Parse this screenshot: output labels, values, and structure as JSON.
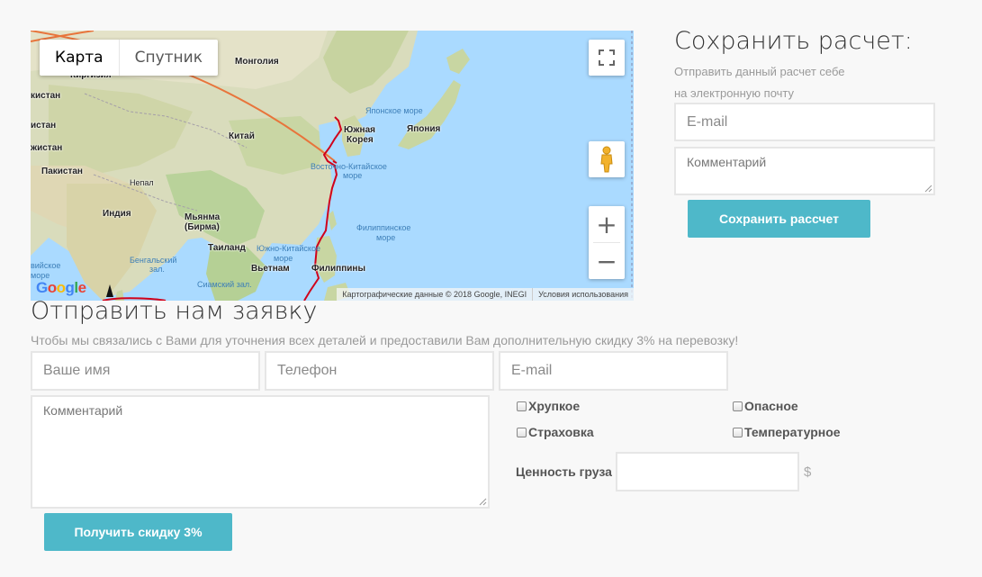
{
  "map": {
    "type_controls": {
      "map_label": "Карта",
      "satellite_label": "Спутник"
    },
    "labels": {
      "mongolia": "Монголия",
      "kyrgyzstan": "Киргизия",
      "stan_fragment": "кистан",
      "stan_fragment2": "истан",
      "china": "Китай",
      "stan_fragment3": "жистан",
      "pakistan": "Пакистан",
      "nepal": "Непал",
      "india": "Индия",
      "myanmar": "Мьянма",
      "myanmar_alt": "(Бирма)",
      "thailand": "Таиланд",
      "vietnam": "Вьетнам",
      "philippines": "Филиппины",
      "south_korea": "Южная",
      "south_korea2": "Корея",
      "japan": "Япония",
      "sea_japan": "Японское море",
      "east_china_sea": "Восточно-Китайское",
      "east_china_sea2": "море",
      "philippine_sea": "Филиппинское",
      "philippine_sea2": "море",
      "south_china_sea": "Южно-Китайское",
      "south_china_sea2": "море",
      "bengal": "Бенгальский",
      "bengal2": "зал.",
      "siam": "Сиамский зал.",
      "arabian": "вийское",
      "arabian2": "море"
    },
    "google_logo": "Google",
    "attribution": "Картографические данные © 2018 Google, INEGI",
    "terms": "Условия использования",
    "zoom_in": "+",
    "zoom_out": "−"
  },
  "save_calc": {
    "title": "Сохранить расчет:",
    "desc_line1": "Отправить данный расчет себе",
    "desc_line2": "на электронную почту",
    "email_placeholder": "E-mail",
    "comment_placeholder": "Комментарий",
    "button": "Сохранить рассчет"
  },
  "order": {
    "title": "Отправить нам заявку",
    "description": "Чтобы мы связались с Вами для уточнения всех деталей и предоставили Вам дополнительную скидку 3% на перевозку!",
    "name_placeholder": "Ваше имя",
    "phone_placeholder": "Телефон",
    "email_placeholder": "E-mail",
    "comment_placeholder": "Комментарий",
    "checkboxes": {
      "fragile": "Хрупкое",
      "dangerous": "Опасное",
      "insurance": "Страховка",
      "temperature": "Температурное"
    },
    "cargo_value_label": "Ценность груза",
    "currency": "$",
    "button": "Получить скидку 3%"
  },
  "colors": {
    "accent": "#4eb8c9",
    "route": "#d0021b",
    "flight_arc": "#e8743b",
    "water": "#aadaff"
  }
}
